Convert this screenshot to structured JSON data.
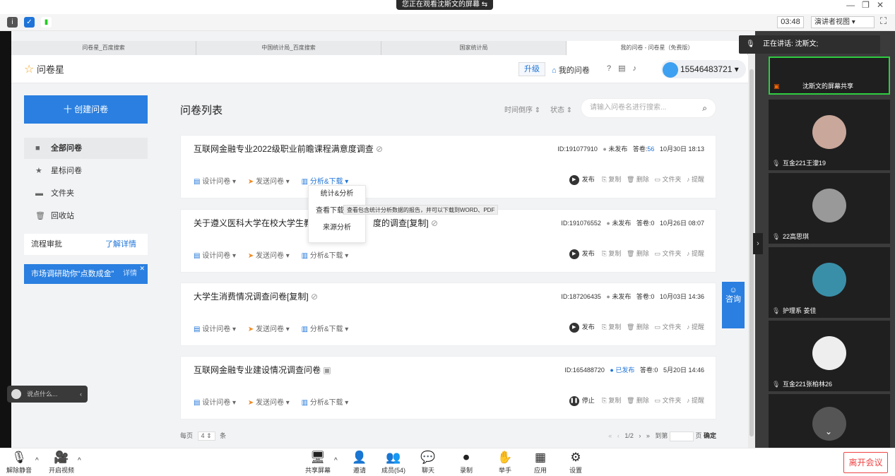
{
  "conference": {
    "banner": "您正在观看沈斯文的屏幕",
    "clock": "03:48",
    "view_mode": "演讲者视图",
    "speaking_label": "正在讲话: 沈斯文;",
    "leave_label": "离开会议",
    "chat_placeholder": "说点什么..."
  },
  "toolbar": [
    {
      "icon": "🎙",
      "label": "解除静音"
    },
    {
      "icon": "🎥",
      "label": "开启视频"
    },
    {
      "icon": "🖥",
      "label": "共享屏幕"
    },
    {
      "icon": "👤",
      "label": "邀请"
    },
    {
      "icon": "👥",
      "label": "成员(54)"
    },
    {
      "icon": "💬",
      "label": "聊天"
    },
    {
      "icon": "⏺",
      "label": "录制"
    },
    {
      "icon": "✋",
      "label": "举手"
    },
    {
      "icon": "▦",
      "label": "应用"
    },
    {
      "icon": "⚙",
      "label": "设置"
    }
  ],
  "participants": [
    {
      "name": "沈斯文的屏幕共享"
    },
    {
      "name": "互金221王濛19"
    },
    {
      "name": "22高思琪"
    },
    {
      "name": "护理系 姜佳"
    },
    {
      "name": "互金221张柏林26"
    }
  ],
  "browser_tabs": [
    {
      "label": "问卷星_百度搜索"
    },
    {
      "label": "中国统计局_百度搜索"
    },
    {
      "label": "国家统计局"
    },
    {
      "label": "我的问卷 - 问卷星（免费版）"
    }
  ],
  "app": {
    "logo": "问卷星",
    "upgrade": "升级",
    "my_surveys": "我的问卷",
    "account": "15546483721",
    "create_button": "十 创建问卷",
    "nav": [
      {
        "label": "全部问卷",
        "icon": "■"
      },
      {
        "label": "星标问卷",
        "icon": "★"
      },
      {
        "label": "文件夹",
        "icon": "▬"
      },
      {
        "label": "回收站",
        "icon": "🗑"
      }
    ],
    "flow_label": "流程审批",
    "flow_more": "了解详情",
    "promo_label": "市场调研助你“点数成金”",
    "promo_more": "详情",
    "list_title": "问卷列表",
    "sort_time": "时间倒序 ⇕",
    "sort_status": "状态 ⇕",
    "search_placeholder": "请输入问卷名进行搜索...",
    "consult": "咨询"
  },
  "surveys": [
    {
      "title": "互联网金融专业2022级职业前瞻课程满意度调查",
      "id": "ID:191077910",
      "status": "未发布",
      "answers_label": "答卷:",
      "answers": "56",
      "date": "10月30日 18:13",
      "publish": "发布"
    },
    {
      "title": "关于遵义医科大学在校大学生教",
      "title2": "度的调查[复制]",
      "id": "ID:191076552",
      "status": "未发布",
      "answers_label": "答卷:",
      "answers": "0",
      "date": "10月26日 08:07",
      "publish": "发布"
    },
    {
      "title": "大学生消费情况调查问卷[复制]",
      "id": "ID:187206435",
      "status": "未发布",
      "answers_label": "答卷:",
      "answers": "0",
      "date": "10月03日 14:36",
      "publish": "发布"
    },
    {
      "title": "互联网金融专业建设情况调查问卷",
      "id": "ID:165488720",
      "status": "已发布",
      "answers_label": "答卷:",
      "answers": "0",
      "date": "5月20日 14:46",
      "publish": "停止"
    }
  ],
  "card_actions": {
    "design": "设计问卷",
    "send": "发送问卷",
    "analyze": "分析&下载",
    "copy": "复制",
    "delete": "删除",
    "folder": "文件夹",
    "remind": "提醒"
  },
  "dropdown": {
    "items": [
      "统计&分析",
      "查看下载答卷",
      "来源分析"
    ],
    "tooltip": "查看包含统计分析数据的报告，并可以下载到WORD、PDF"
  },
  "pager": {
    "per_page_label": "每页",
    "per_page": "4",
    "unit": "条",
    "page": "1/2",
    "goto": "到第",
    "page_unit": "页",
    "confirm": "确定"
  }
}
